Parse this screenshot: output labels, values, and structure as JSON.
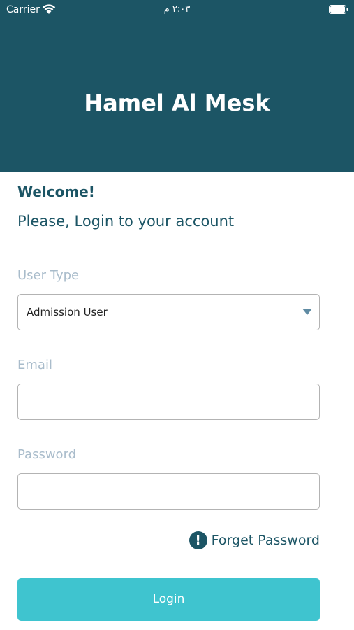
{
  "status_bar": {
    "carrier": "Carrier",
    "time": "٢:٠٣ م",
    "wifi_icon": "wifi-icon",
    "battery_icon": "battery-icon"
  },
  "header": {
    "title": "Hamel Al Mesk",
    "background_color": "#1c5565"
  },
  "intro": {
    "welcome": "Welcome!",
    "subtitle": "Please, Login to your account"
  },
  "form": {
    "user_type": {
      "label": "User Type",
      "selected_value": "Admission User"
    },
    "email": {
      "label": "Email",
      "value": "",
      "placeholder": ""
    },
    "password": {
      "label": "Password",
      "value": "",
      "placeholder": ""
    },
    "forget_password": {
      "label": "Forget Password",
      "icon": "alert-circle-icon"
    },
    "login_button": {
      "label": "Login",
      "color": "#3fc4cf"
    }
  }
}
